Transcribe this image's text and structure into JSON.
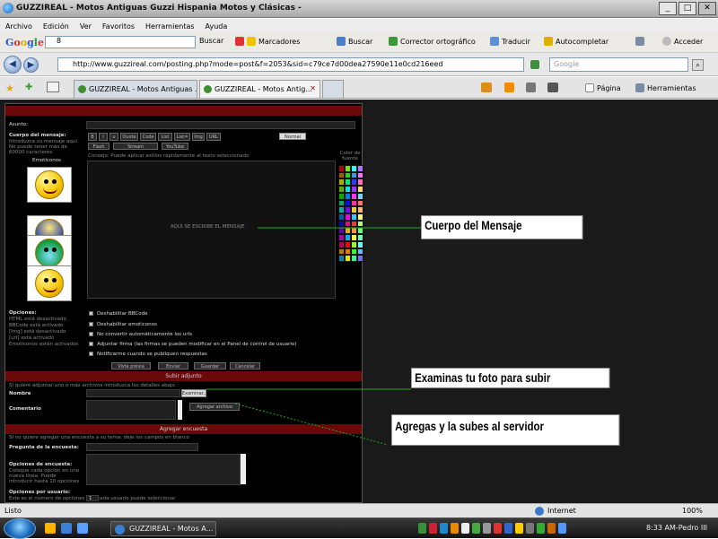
{
  "window": {
    "title": "GUZZIREAL - Motos Antiguas Guzzi Hispania Motos y Clásicas -"
  },
  "menu": [
    "Archivo",
    "Edición",
    "Ver",
    "Favoritos",
    "Herramientas",
    "Ayuda"
  ],
  "googlebar": {
    "search_value": "8",
    "buscar": "Buscar",
    "marcadores": "Marcadores",
    "buscar2": "Buscar",
    "corrector": "Corrector ortográfico",
    "traducir": "Traducir",
    "autocompletar": "Autocompletar",
    "acceder": "Acceder"
  },
  "address": {
    "url": "http://www.guzzireal.com/posting.php?mode=post&f=2053&sid=c79ce7d00dea27590e11e0cd216eed",
    "search_placeholder": "Google"
  },
  "tabs": [
    {
      "label": "GUZZIREAL - Motos Antiguas ..."
    },
    {
      "label": "GUZZIREAL - Motos Antig..."
    }
  ],
  "commandbar": {
    "pagina": "Página",
    "herramientas": "Herramientas"
  },
  "forum": {
    "asunto": "Asunto:",
    "cuerpo_label": "Cuerpo del mensaje:",
    "cuerpo_hint": "Introduzca su mensaje aquí. No puede tener más de 60000 caracteres",
    "emoticonos": "Emoticonos",
    "format_buttons": [
      "B",
      "i",
      "u",
      "Quote",
      "Code",
      "List",
      "List=",
      "Img",
      "URL"
    ],
    "format_buttons2": [
      "Flash",
      "Stream",
      "YouTube"
    ],
    "toolbar_hint": "Consejo: Puede aplicar estilos rápidamente al texto seleccionado",
    "font_select": "Normal",
    "color_label": "Color de fuente",
    "body_placeholder": "AQUI SE ESCRIBE EL MENSAJE",
    "opciones": "Opciones:",
    "opciones_list": [
      "HTML está desactivado",
      "BBCode está activado",
      "[Img] está desactivado",
      "[url] está activado",
      "Emoticonos están activados"
    ],
    "checkboxes": [
      "Deshabilitar BBCode",
      "Deshabilitar emoticonos",
      "No convertir automáticamente los urls",
      "Adjuntar firma (las firmas se pueden modificar en el Panel de control de usuario)",
      "Notificarme cuando se publiquen respuestas"
    ],
    "action_buttons": [
      "Vista previa",
      "Enviar",
      "Guardar",
      "Cancelar"
    ],
    "subir_header": "Subir adjunto",
    "subir_hint": "Si quiere adjuntar uno o más archivos introduzca los detalles abajo",
    "nombre": "Nombre",
    "examinar": "Examinar...",
    "comentario": "Comentario",
    "agregar": "Agregar archivo",
    "encuesta_header": "Agregar encuesta",
    "encuesta_hint": "Si no quiere agregar una encuesta a su tema, deje los campos en blanco",
    "pregunta": "Pregunta de la encuesta:",
    "opciones_encuesta": "Opciones de encuesta:",
    "opciones_encuesta_hint": "Coloque cada opción en una nueva línea. Puede introducir hasta 10 opciones",
    "opciones_usuario": "Opciones por usuario:",
    "opciones_usuario_hint": "Este es el número de opciones que cada usuario puede seleccionar",
    "opciones_usuario_value": "1"
  },
  "callouts": {
    "cuerpo": "Cuerpo del Mensaje",
    "examinas": "Examinas tu foto para subir",
    "agregas": "Agregas y la subes al servidor"
  },
  "status": {
    "left": "Listo",
    "zone": "Internet",
    "zoom": "100%"
  },
  "taskbar": {
    "task": "GUZZIREAL - Motos A...",
    "clock": "8:33 AM-Pedro III"
  },
  "colors": {
    "forum_bg": "#000000",
    "header_red": "#6b0808",
    "callout_line": "#22aa22"
  }
}
